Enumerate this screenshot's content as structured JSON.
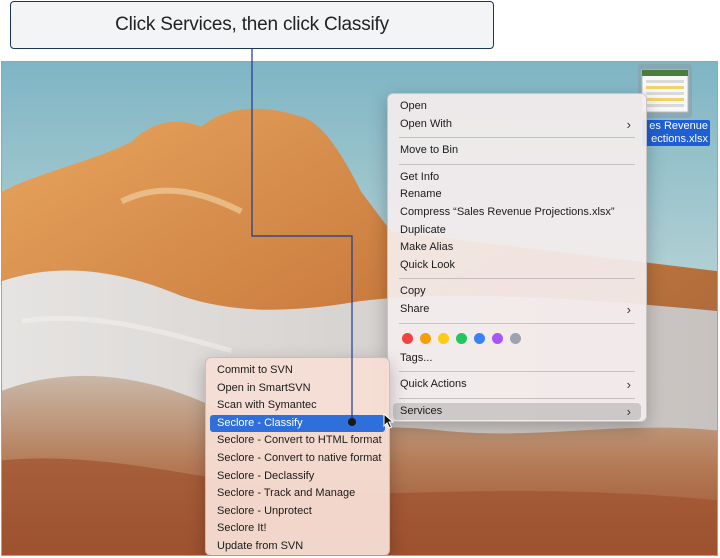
{
  "instruction": "Click Services, then click Classify",
  "desktop_file": {
    "label_line1": "es Revenue",
    "label_line2": "ections.xlsx"
  },
  "context_menu": {
    "group1": [
      {
        "label": "Open",
        "submenu": false
      },
      {
        "label": "Open With",
        "submenu": true
      }
    ],
    "group2": [
      {
        "label": "Move to Bin",
        "submenu": false
      }
    ],
    "group3": [
      {
        "label": "Get Info",
        "submenu": false
      },
      {
        "label": "Rename",
        "submenu": false
      },
      {
        "label": "Compress “Sales Revenue Projections.xlsx”",
        "submenu": false
      },
      {
        "label": "Duplicate",
        "submenu": false
      },
      {
        "label": "Make Alias",
        "submenu": false
      },
      {
        "label": "Quick Look",
        "submenu": false
      }
    ],
    "group4": [
      {
        "label": "Copy",
        "submenu": false
      },
      {
        "label": "Share",
        "submenu": true
      }
    ],
    "tag_colors": [
      "#ef4444",
      "#f59e0b",
      "#facc15",
      "#22c55e",
      "#3b82f6",
      "#a855f7",
      "#9ca3af"
    ],
    "tags_label": "Tags...",
    "group5": [
      {
        "label": "Quick Actions",
        "submenu": true
      }
    ],
    "group6": [
      {
        "label": "Services",
        "submenu": true
      }
    ]
  },
  "services_submenu": {
    "items": [
      "Commit to SVN",
      "Open in SmartSVN",
      "Scan with Symantec",
      "Seclore - Classify",
      "Seclore - Convert to HTML format",
      "Seclore - Convert to native format",
      "Seclore - Declassify",
      "Seclore - Track and Manage",
      "Seclore - Unprotect",
      "Seclore It!",
      "Update from SVN"
    ],
    "highlighted_index": 3
  },
  "colors": {
    "highlight": "#2f6fdb",
    "connector": "#1d3a8a"
  }
}
